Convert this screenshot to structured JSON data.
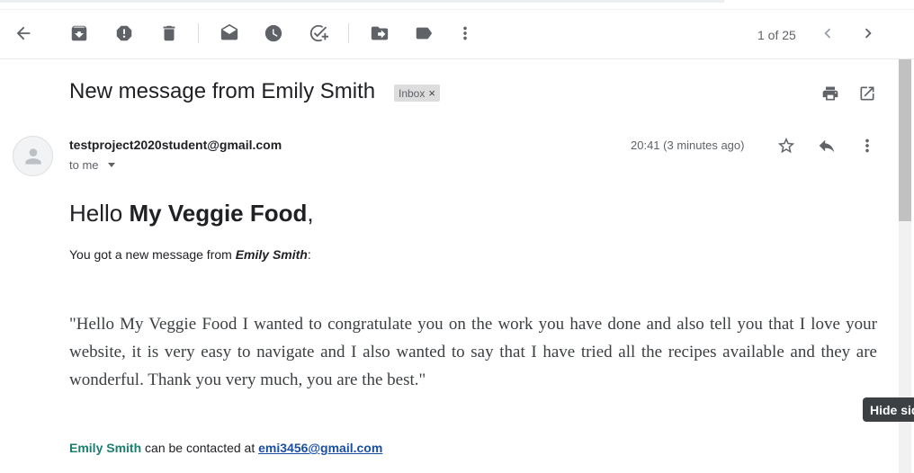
{
  "toolbar": {
    "back_icon": "arrow-left-icon",
    "archive_icon": "archive-icon",
    "spam_icon": "report-spam-icon",
    "delete_icon": "trash-icon",
    "mark_unread_icon": "mark-unread-icon",
    "snooze_icon": "clock-icon",
    "add_task_icon": "add-task-icon",
    "move_icon": "move-to-icon",
    "label_icon": "label-icon",
    "more_icon": "more-vert-icon",
    "pager": "1 of 25",
    "prev_icon": "chevron-left-icon",
    "next_icon": "chevron-right-icon"
  },
  "email": {
    "subject": "New message from Emily Smith",
    "label": "Inbox",
    "label_remove": "×",
    "sender": "testproject2020student@gmail.com",
    "recipient": "to me",
    "time": "20:41 (3 minutes ago)"
  },
  "body": {
    "greeting_prefix": "Hello ",
    "greeting_name": "My Veggie Food",
    "greeting_suffix": ",",
    "intro_prefix": "You got a new message from ",
    "intro_name": "Emily Smith",
    "intro_suffix": ":",
    "quote": "\"Hello My Veggie Food I wanted to congratulate you on the work you have done and also tell you that I love your website, it is very easy to navigate and I also wanted to say that I have tried all the recipes available and they are wonderful. Thank you very much, you are the best.\"",
    "contact_name": "Emily Smith",
    "contact_middle": " can be contacted at ",
    "contact_email": "emi3456@gmail.com"
  },
  "tooltip": {
    "text": "Hide side panel"
  },
  "colors": {
    "accent_name": "#1a7f6e",
    "link": "#1a4fa0"
  }
}
